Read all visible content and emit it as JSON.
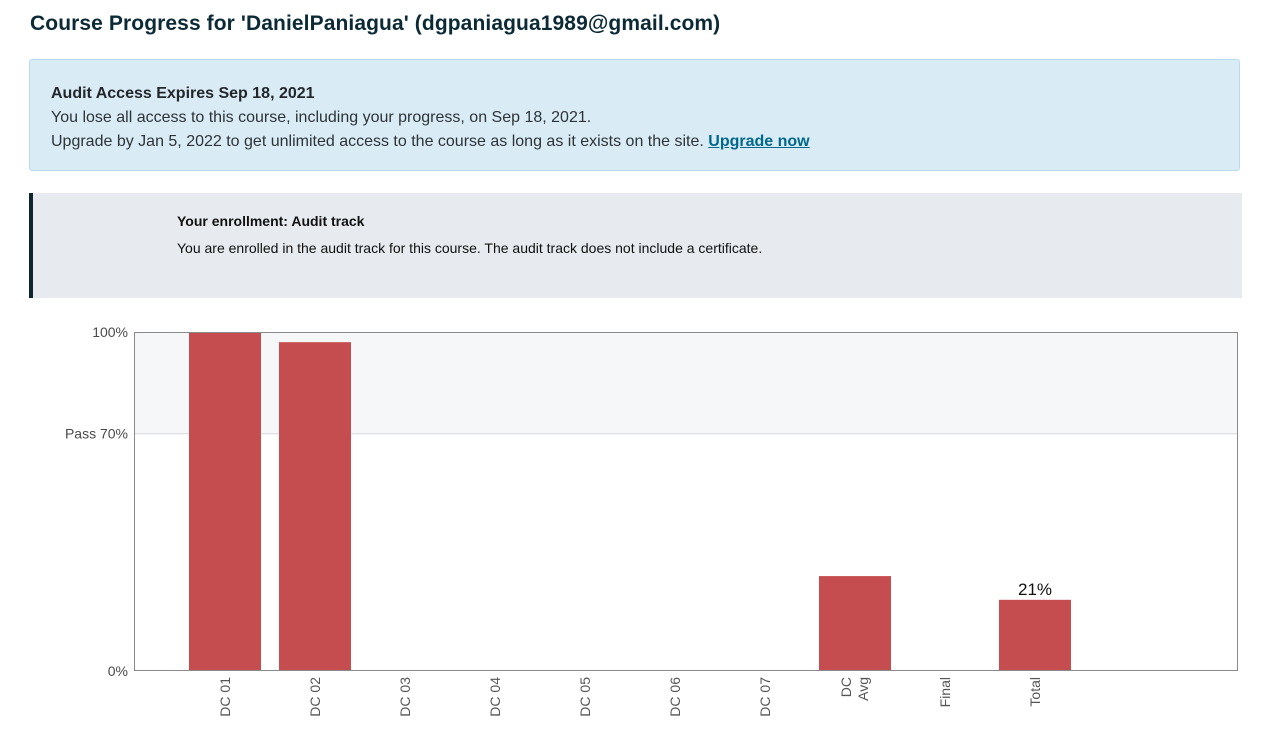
{
  "page": {
    "title": "Course Progress for 'DanielPaniagua' (dgpaniagua1989@gmail.com)"
  },
  "audit_banner": {
    "title": "Audit Access Expires Sep 18, 2021",
    "line1": "You lose all access to this course, including your progress, on Sep 18, 2021.",
    "line2": "Upgrade by Jan 5, 2022 to get unlimited access to the course as long as it exists on the site.",
    "upgrade_link": "Upgrade now"
  },
  "enrollment": {
    "title": "Your enrollment: Audit track",
    "message": "You are enrolled in the audit track for this course. The audit track does not include a certificate."
  },
  "colors": {
    "bar": "#c64d4f",
    "pass_band": "#f6f7f9",
    "axis": "#8a8a8a",
    "link": "#00688d"
  },
  "chart_data": {
    "type": "bar",
    "categories": [
      "DC 01",
      "DC 02",
      "DC 03",
      "DC 04",
      "DC 05",
      "DC 06",
      "DC 07",
      "DC Avg",
      "Final",
      "Total"
    ],
    "values": [
      100,
      97,
      0,
      0,
      0,
      0,
      0,
      28,
      0,
      21
    ],
    "data_labels": [
      "",
      "",
      "",
      "",
      "",
      "",
      "",
      "",
      "",
      "21%"
    ],
    "y_ticks": [
      {
        "value": 100,
        "label": "100%"
      },
      {
        "value": 70,
        "label": "Pass 70%"
      },
      {
        "value": 0,
        "label": "0%"
      }
    ],
    "pass_threshold": 70,
    "ylim": [
      0,
      100
    ],
    "title": "",
    "xlabel": "",
    "ylabel": ""
  }
}
